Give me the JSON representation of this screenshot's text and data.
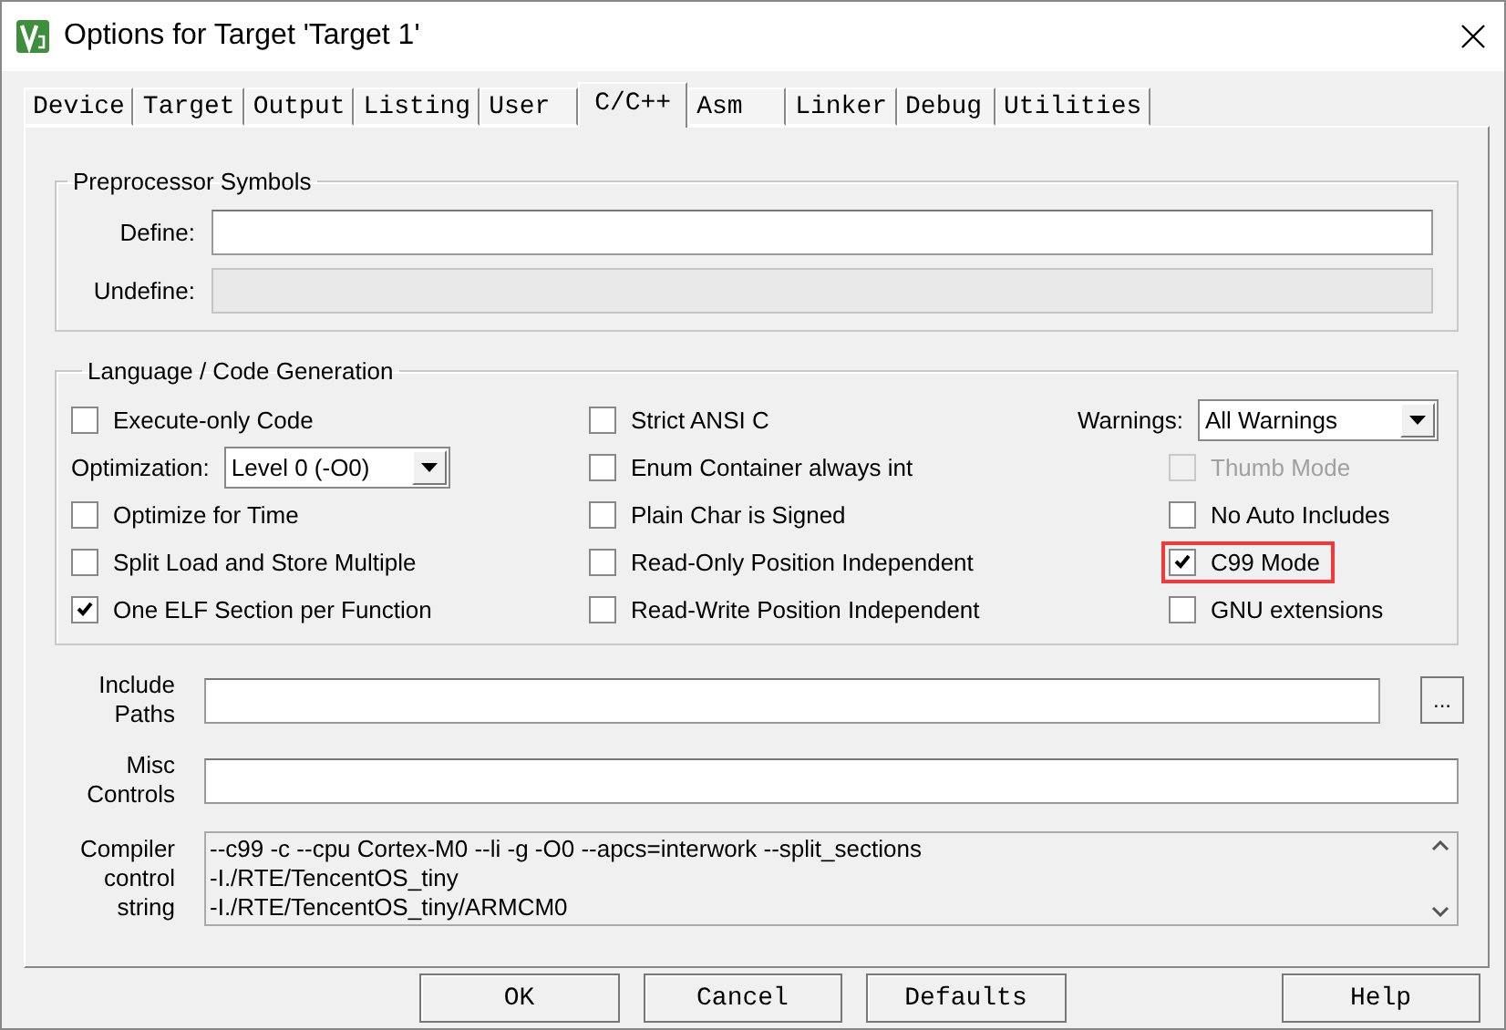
{
  "window": {
    "title": "Options for Target 'Target 1'"
  },
  "tabs": [
    {
      "label": "Device",
      "selected": false
    },
    {
      "label": "Target",
      "selected": false
    },
    {
      "label": "Output",
      "selected": false
    },
    {
      "label": "Listing",
      "selected": false
    },
    {
      "label": "User",
      "selected": false
    },
    {
      "label": "C/C++",
      "selected": true
    },
    {
      "label": "Asm",
      "selected": false
    },
    {
      "label": "Linker",
      "selected": false
    },
    {
      "label": "Debug",
      "selected": false
    },
    {
      "label": "Utilities",
      "selected": false
    }
  ],
  "preprocessor": {
    "title": "Preprocessor Symbols",
    "fields": [
      {
        "label": "Define:",
        "disabled": false
      },
      {
        "label": "Undefine:",
        "disabled": true
      }
    ]
  },
  "language": {
    "title": "Language / Code Generation",
    "columns": [
      [
        {
          "kind": "checkbox",
          "label": "Execute-only Code",
          "checked": false,
          "disabled": false,
          "highlighted": false
        },
        {
          "kind": "select",
          "label": "Optimization:",
          "value": "Level 0 (-O0)"
        },
        {
          "kind": "checkbox",
          "label": "Optimize for Time",
          "checked": false,
          "disabled": false,
          "highlighted": false
        },
        {
          "kind": "checkbox",
          "label": "Split Load and Store Multiple",
          "checked": false,
          "disabled": false,
          "highlighted": false
        },
        {
          "kind": "checkbox",
          "label": "One ELF Section per Function",
          "checked": true,
          "disabled": false,
          "highlighted": false
        }
      ],
      [
        {
          "kind": "checkbox",
          "label": "Strict ANSI C",
          "checked": false,
          "disabled": false,
          "highlighted": false
        },
        {
          "kind": "checkbox",
          "label": "Enum Container always int",
          "checked": false,
          "disabled": false,
          "highlighted": false
        },
        {
          "kind": "checkbox",
          "label": "Plain Char is Signed",
          "checked": false,
          "disabled": false,
          "highlighted": false
        },
        {
          "kind": "checkbox",
          "label": "Read-Only Position Independent",
          "checked": false,
          "disabled": false,
          "highlighted": false
        },
        {
          "kind": "checkbox",
          "label": "Read-Write Position Independent",
          "checked": false,
          "disabled": false,
          "highlighted": false
        }
      ],
      [
        {
          "kind": "select",
          "label": "Warnings:",
          "value": "All Warnings"
        },
        {
          "kind": "checkbox",
          "label": "Thumb Mode",
          "checked": false,
          "disabled": true,
          "highlighted": false
        },
        {
          "kind": "checkbox",
          "label": "No Auto Includes",
          "checked": false,
          "disabled": false,
          "highlighted": false
        },
        {
          "kind": "checkbox",
          "label": "C99 Mode",
          "checked": true,
          "disabled": false,
          "highlighted": true
        },
        {
          "kind": "checkbox",
          "label": "GNU extensions",
          "checked": false,
          "disabled": false,
          "highlighted": false
        }
      ]
    ]
  },
  "include_paths": {
    "label": [
      "Include",
      "Paths"
    ],
    "browse": "..."
  },
  "misc_controls": {
    "label": [
      "Misc",
      "Controls"
    ]
  },
  "compiler_control_string": {
    "label": [
      "Compiler",
      "control",
      "string"
    ],
    "lines": [
      "--c99 -c --cpu Cortex-M0 --li -g -O0 --apcs=interwork --split_sections",
      "-I./RTE/TencentOS_tiny",
      "-I./RTE/TencentOS_tiny/ARMCM0"
    ]
  },
  "buttons": [
    "OK",
    "Cancel",
    "Defaults",
    "Help"
  ]
}
